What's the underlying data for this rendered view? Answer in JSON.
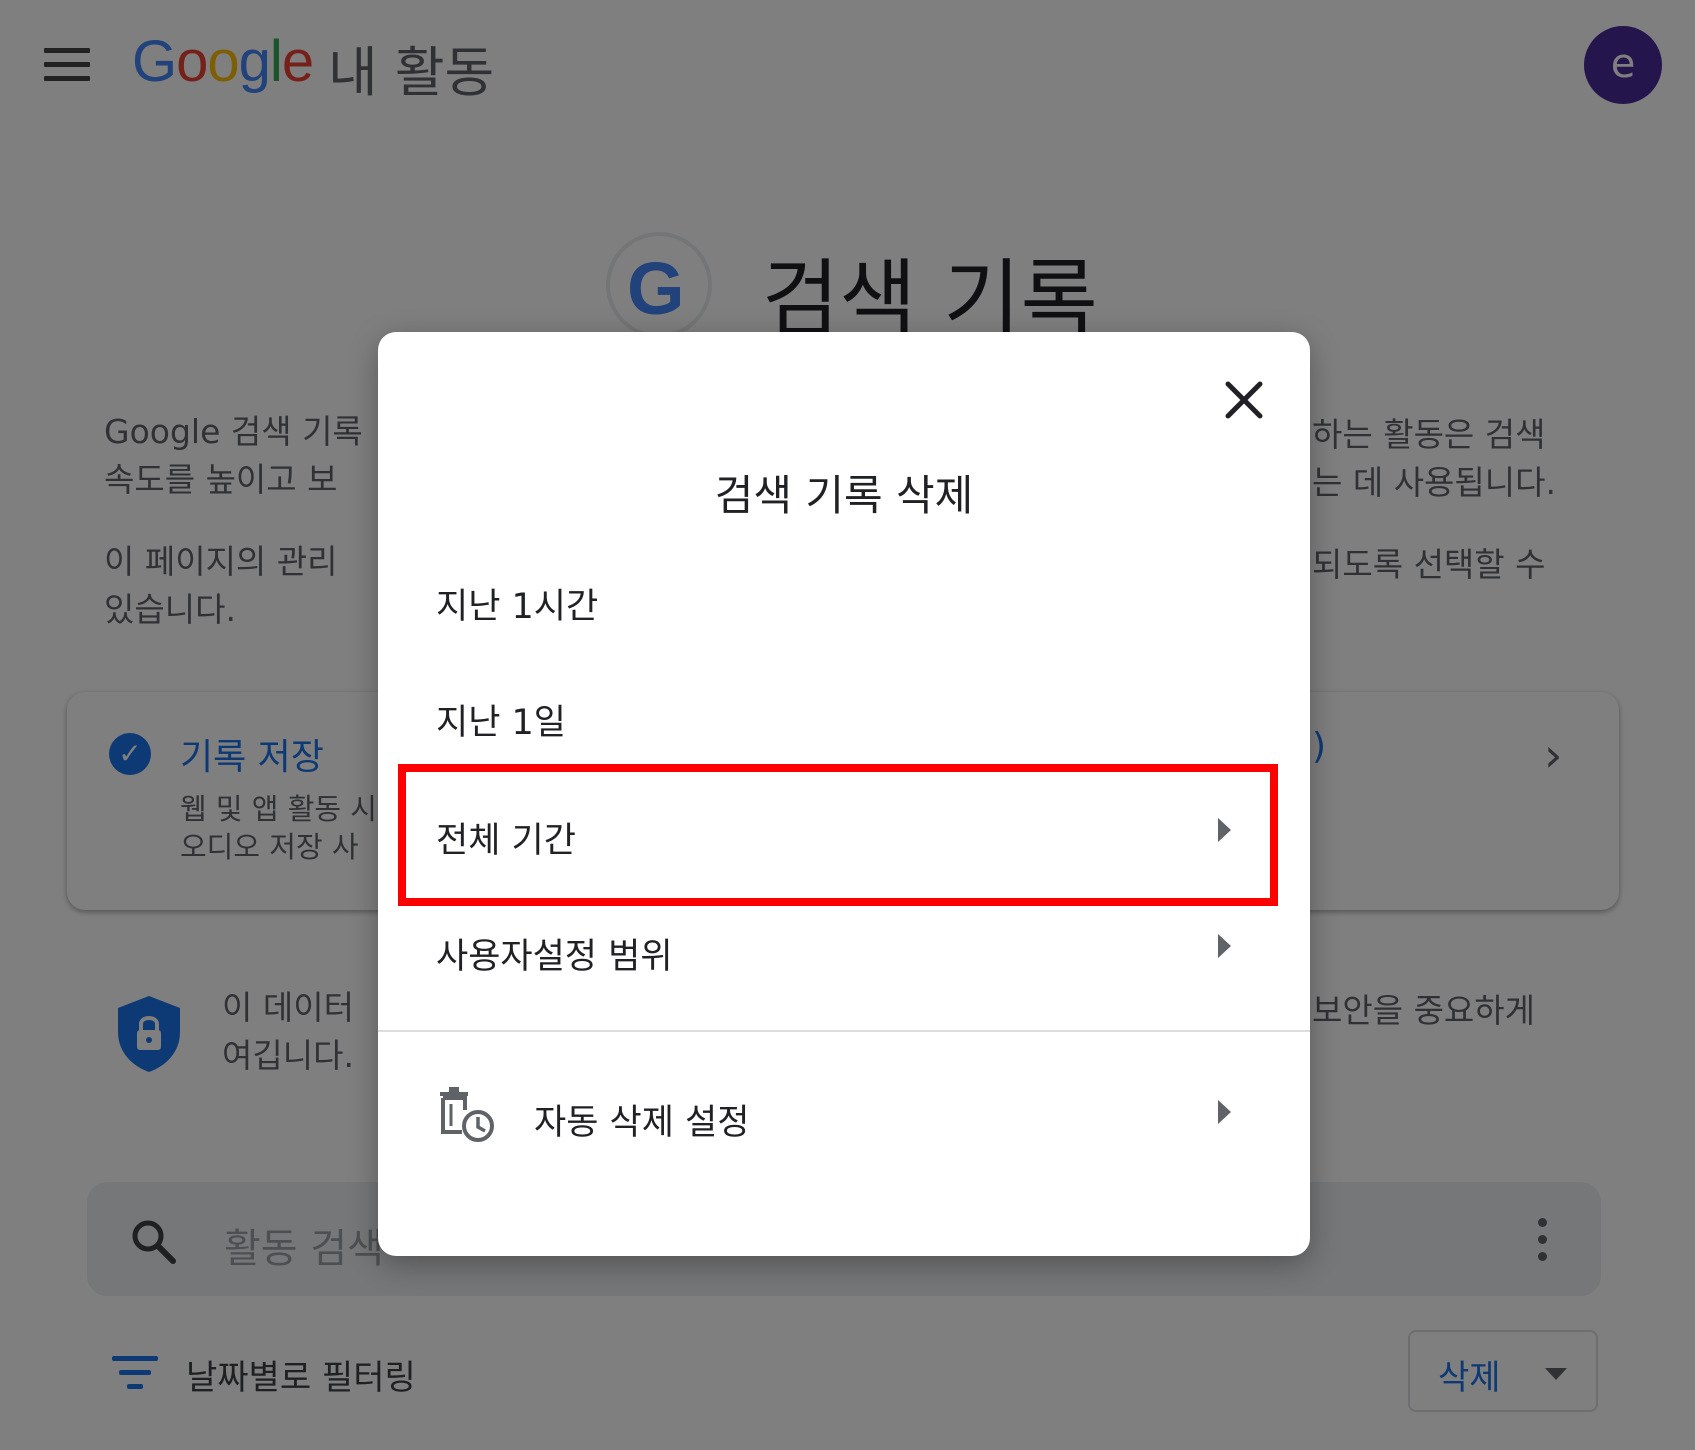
{
  "header": {
    "logo_text": "Google",
    "app_name": "내 활동",
    "avatar_letter": "e"
  },
  "page": {
    "title": "검색 기록",
    "intro_line1_left": "Google 검색 기록",
    "intro_line1_right": "하는 활동은 검색",
    "intro_line2_left": "속도를 높이고 보",
    "intro_line2_right": "는 데 사용됩니다.",
    "intro2_line1_left": "이 페이지의 관리",
    "intro2_line1_right": "되도록 선택할 수",
    "intro2_line2_left": "있습니다."
  },
  "card": {
    "title": "기록 저장",
    "sub_line1": "웹 및 앱 활동 시",
    "sub_line2": "오디오 저장 사",
    "right_fragment": ")"
  },
  "privacy": {
    "line1_left": "이 데이터",
    "line1_right": "보안을 중요하게",
    "line2_left": "여깁니다."
  },
  "search": {
    "placeholder": "활동 검색"
  },
  "filter": {
    "label": "날짜별로 필터링"
  },
  "delete_button": {
    "label": "삭제"
  },
  "dialog": {
    "title": "검색 기록 삭제",
    "options": [
      {
        "label": "지난 1시간"
      },
      {
        "label": "지난 1일"
      },
      {
        "label": "전체 기간"
      },
      {
        "label": "사용자설정 범위"
      }
    ],
    "auto_delete_label": "자동 삭제 설정"
  },
  "colors": {
    "accent": "#1a73e8",
    "highlight": "#ff0000",
    "avatar": "#4a2a9a"
  }
}
